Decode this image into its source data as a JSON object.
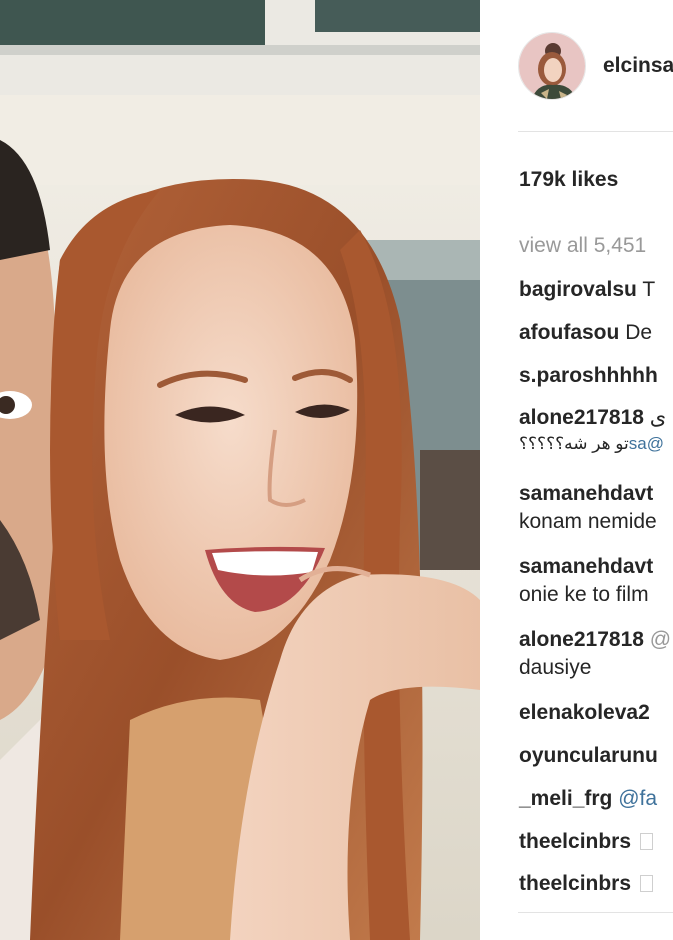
{
  "post": {
    "username": "elcinsa",
    "likes": "179k likes",
    "view_all": "view all 5,451"
  },
  "comments": [
    {
      "user": "bagirovalsu",
      "text": "T"
    },
    {
      "user": "afoufasou",
      "text": "De"
    },
    {
      "user": "s.paroshhhhh",
      "text": ""
    },
    {
      "user": "alone217818",
      "text": " ی",
      "line2_mention": "sa@",
      "line2_text": "تو هر شه؟؟؟؟؟"
    },
    {
      "user": "samanehdavt",
      "text": "",
      "line2_text": "konam nemide"
    },
    {
      "user": "samanehdavt",
      "text": "",
      "line2_text": "onie ke to film"
    },
    {
      "user": "alone217818",
      "text": " @",
      "line2_text": "dausiye"
    },
    {
      "user": "elenakoleva2",
      "text": ""
    },
    {
      "user": "oyuncularunu",
      "text": ""
    },
    {
      "user": "_meli_frg",
      "mention": "@fa"
    },
    {
      "user": "theelcinbrs",
      "box": true
    },
    {
      "user": "theelcinbrs",
      "box": true
    }
  ],
  "icons": {
    "avatar": "profile-avatar"
  },
  "colors": {
    "text": "#262626",
    "muted": "#999999",
    "link": "#3f729b",
    "divider": "#e3e3e3"
  }
}
